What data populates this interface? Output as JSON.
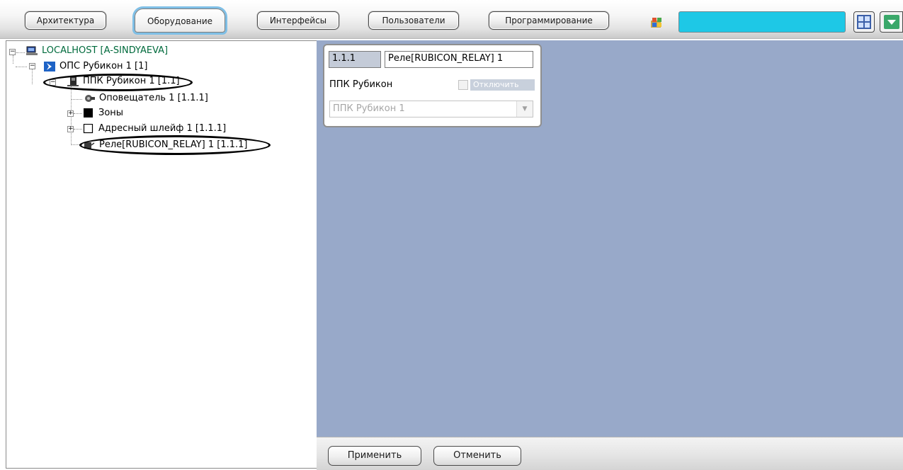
{
  "tabs": [
    {
      "label": "Архитектура",
      "active": false
    },
    {
      "label": "Оборудование",
      "active": true
    },
    {
      "label": "Интерфейсы",
      "active": false
    },
    {
      "label": "Пользователи",
      "active": false
    },
    {
      "label": "Программирование",
      "active": false
    }
  ],
  "toolbar": {
    "system_icon": "windows-flag-icon",
    "search_color": "#1ec8e6",
    "grid_icon": "grid-view-icon",
    "dropdown_icon": "chevron-down-icon"
  },
  "tree": {
    "nodes": [
      {
        "label": "LOCALHOST [A-SINDYAEVA]",
        "icon": "computer-icon",
        "color": "#006a3c"
      },
      {
        "label": "ОПС Рубикон 1 [1]",
        "icon": "rubicon-logo-icon"
      },
      {
        "label": "ППК Рубикон 1 [1.1]",
        "icon": "panel-device-icon",
        "highlighted": true
      },
      {
        "label": "Оповещатель 1 [1.1.1]",
        "icon": "siren-icon"
      },
      {
        "label": "Зоны",
        "icon": "zone-icon"
      },
      {
        "label": "Адресный шлейф 1 [1.1.1]",
        "icon": "loop-icon"
      },
      {
        "label": "Реле[RUBICON_RELAY] 1 [1.1.1]",
        "icon": "relay-icon",
        "highlighted": true
      }
    ]
  },
  "properties": {
    "id_value": "1.1.1",
    "name_value": "Реле[RUBICON_RELAY] 1",
    "parent_label": "ППК Рубикон",
    "disable_label": "Отключить",
    "disable_checked": false,
    "parent_select_value": "ППК Рубикон 1"
  },
  "buttons": {
    "apply_label": "Применить",
    "cancel_label": "Отменить"
  },
  "colors": {
    "workspace_bg": "#98a9c9",
    "active_tab_glow": "#7fbfe6",
    "tree_root_text": "#006a3c"
  }
}
